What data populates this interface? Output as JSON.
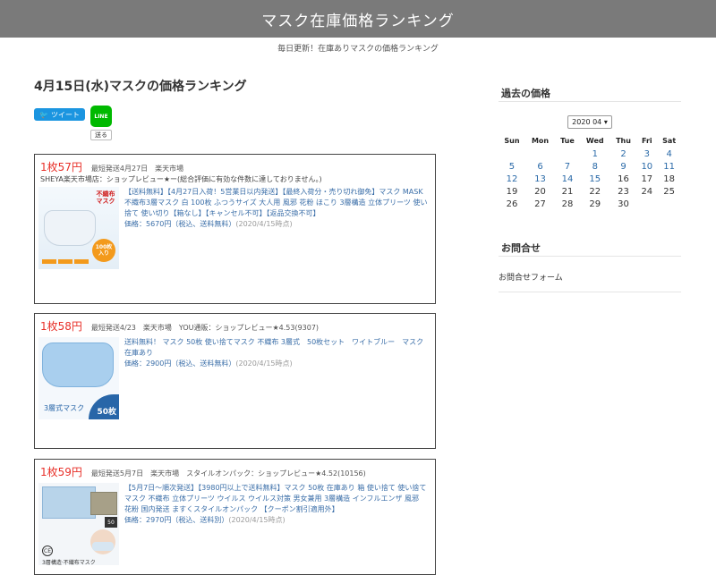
{
  "header": {
    "site_title": "マスク在庫価格ランキング",
    "site_description": "毎日更新！在庫ありマスクの価格ランキング"
  },
  "main": {
    "page_title": "4月15日(水)マスクの価格ランキング",
    "share": {
      "tweet_label": "ツイート",
      "line_logo": "LINE",
      "line_label": "送る"
    },
    "products": [
      {
        "price": "1枚57円",
        "meta": "最短発送4月27日　楽天市場",
        "shop": "SHEYA楽天市場店：ショップレビュー★ー(総合評価に有効な件数に達しておりません。)",
        "title": "【送料無料】【4月27日入荷！5営業日以内発送】【最終入荷分・売り切れ御免】マスク MASK 不織布3層マスク 白 100枚 ふつうサイズ 大人用 風邪 花粉 ほこり 3層構造 立体プリーツ 使い捨て 使い切り【箱なし】【キャンセル不可】【返品交換不可】",
        "price_line": "価格：5670円（税込、送料無料）",
        "date": "(2020/4/15時点)",
        "thumb": {
          "label_top": "不織布",
          "label_bottom": "マスク",
          "badge_top": "100枚",
          "badge_bottom": "入り"
        }
      },
      {
        "price": "1枚58円",
        "meta": "最短発送4/23　楽天市場　YOU通販：ショップレビュー★4.53(9307)",
        "shop": "",
        "title": "送料無料！ マスク 50枚 使い捨てマスク 不織布 3層式　50枚セット　ワイトブルー　マスク 在庫あり",
        "price_line": "価格：2900円（税込、送料無料）",
        "date": "(2020/4/15時点)",
        "thumb": {
          "caption": "3層式マスク",
          "corner": "50枚"
        }
      },
      {
        "price": "1枚59円",
        "meta": "最短発送5月7日　楽天市場　スタイルオンパック：ショップレビュー★4.52(10156)",
        "shop": "",
        "title": "【5月7日～順次発送】【3980円以上で送料無料】マスク 50枚 在庫あり 箱 使い捨て 使い捨てマスク 不織布 立体プリーツ ウイルス ウイルス対策 男女兼用 3層構造 インフルエンザ 風邪 花粉 国内発送 ますくスタイルオンパック 【クーポン割引適用外】",
        "price_line": "価格：2970円（税込、送料別）",
        "date": "(2020/4/15時点)",
        "thumb": {
          "badge": "50",
          "caption": "3層構造·不織布マスク",
          "ce": "CE"
        }
      }
    ]
  },
  "sidebar": {
    "calendar": {
      "title": "過去の価格",
      "selected_month": "2020 04",
      "weekdays": [
        "Sun",
        "Mon",
        "Tue",
        "Wed",
        "Thu",
        "Fri",
        "Sat"
      ],
      "weeks": [
        [
          "",
          "",
          "",
          "1",
          "2",
          "3",
          "4"
        ],
        [
          "5",
          "6",
          "7",
          "8",
          "9",
          "10",
          "11"
        ],
        [
          "12",
          "13",
          "14",
          "15",
          "16",
          "17",
          "18"
        ],
        [
          "19",
          "20",
          "21",
          "22",
          "23",
          "24",
          "25"
        ],
        [
          "26",
          "27",
          "28",
          "29",
          "30",
          "",
          ""
        ]
      ],
      "linked_days": [
        "1",
        "2",
        "3",
        "4",
        "5",
        "6",
        "7",
        "8",
        "9",
        "10",
        "11",
        "12",
        "13",
        "14",
        "15"
      ]
    },
    "contact": {
      "title": "お問合せ",
      "link_label": "お問合せフォーム"
    }
  },
  "colors": {
    "header_bg": "#7a7a7a",
    "price_red": "#e8312a",
    "link_blue": "#3a6ea8",
    "tweet_blue": "#1b95e0",
    "line_green": "#00b900"
  }
}
